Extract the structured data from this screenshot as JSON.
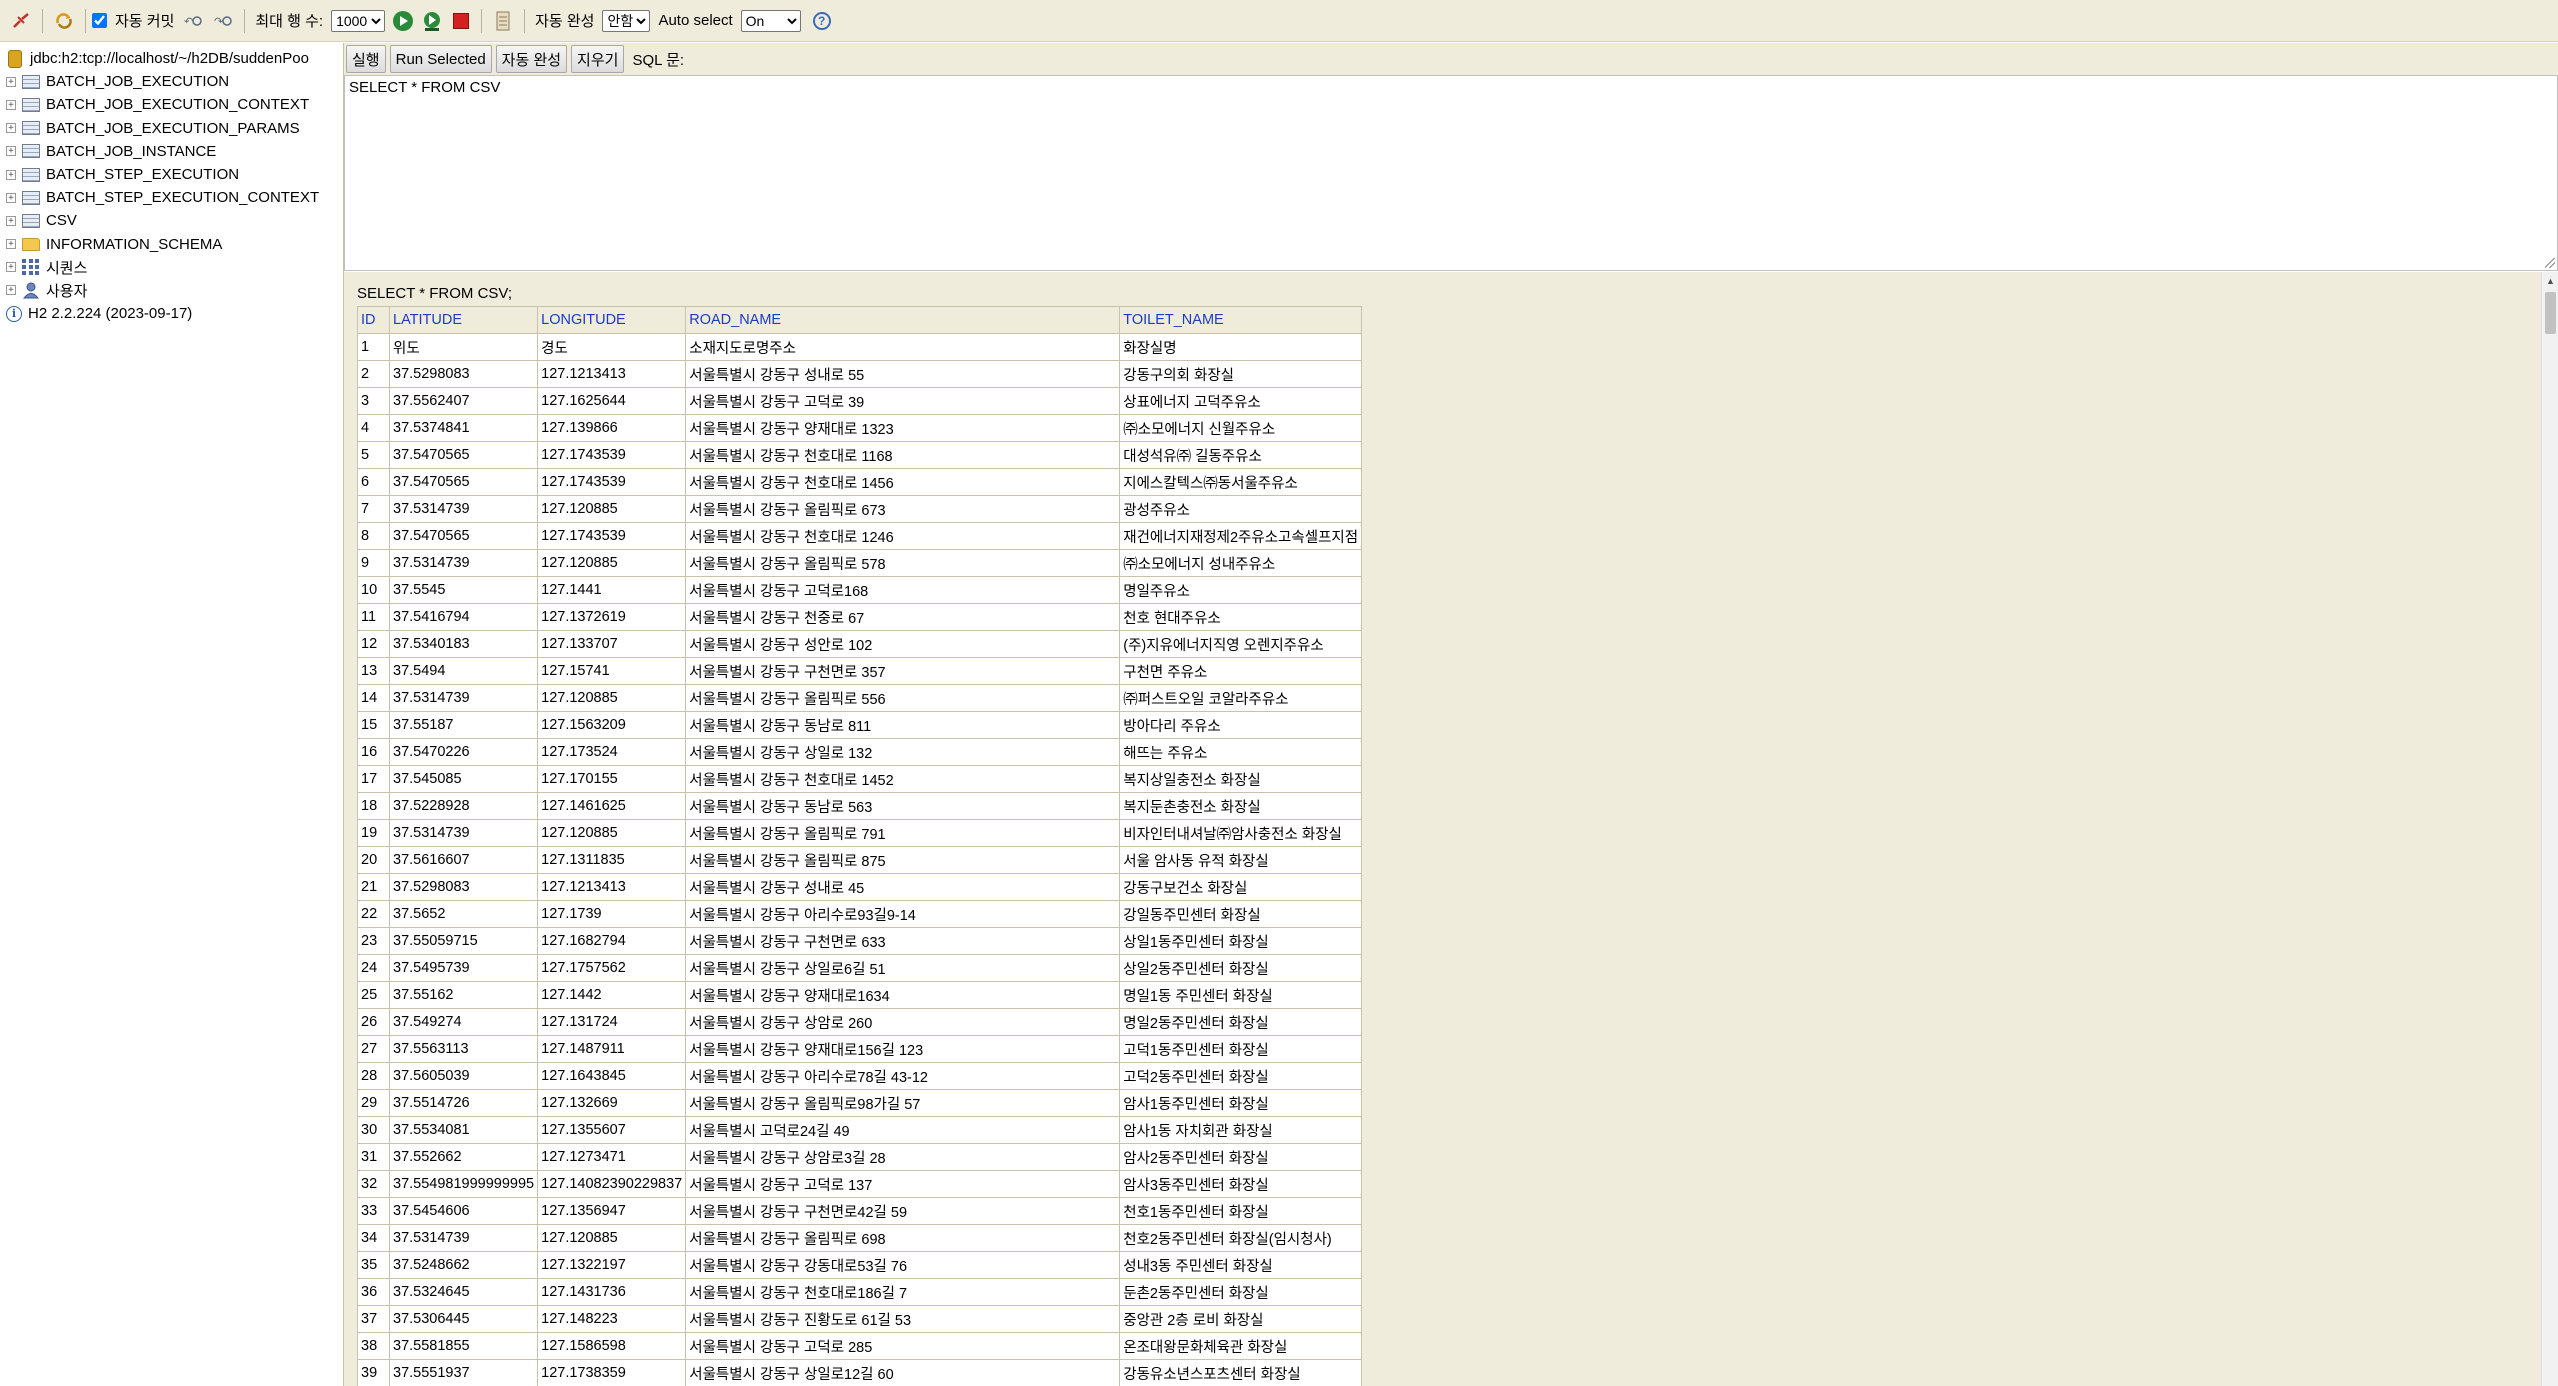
{
  "toolbar": {
    "autocommit_label": "자동 커밋",
    "autocommit_checked": true,
    "max_rows_label": "최대 행 수:",
    "max_rows_value": "1000",
    "autocomplete_label": "자동 완성",
    "autocomplete_value": "안함",
    "autoselect_label": "Auto select",
    "autoselect_value": "On",
    "help_glyph": "?"
  },
  "tree": {
    "connection": "jdbc:h2:tcp://localhost/~/h2DB/suddenPoo",
    "tables": [
      "BATCH_JOB_EXECUTION",
      "BATCH_JOB_EXECUTION_CONTEXT",
      "BATCH_JOB_EXECUTION_PARAMS",
      "BATCH_JOB_INSTANCE",
      "BATCH_STEP_EXECUTION",
      "BATCH_STEP_EXECUTION_CONTEXT",
      "CSV"
    ],
    "schema": "INFORMATION_SCHEMA",
    "sequences": "시퀀스",
    "users": "사용자",
    "version": "H2 2.2.224 (2023-09-17)"
  },
  "sql_toolbar": {
    "run": "실행",
    "run_selected": "Run Selected",
    "autocomplete": "자동 완성",
    "clear": "지우기",
    "sql_label": "SQL 문:"
  },
  "sql_editor": {
    "text": "SELECT * FROM CSV"
  },
  "result": {
    "query": "SELECT * FROM CSV;",
    "columns": [
      "ID",
      "LATITUDE",
      "LONGITUDE",
      "ROAD_NAME",
      "TOILET_NAME"
    ],
    "rows": [
      [
        "1",
        "위도",
        "경도",
        "소재지도로명주소",
        "화장실명"
      ],
      [
        "2",
        "37.5298083",
        "127.1213413",
        "서울특별시 강동구 성내로 55",
        "강동구의회 화장실"
      ],
      [
        "3",
        "37.5562407",
        "127.1625644",
        "서울특별시 강동구 고덕로 39",
        "상표에너지 고덕주유소"
      ],
      [
        "4",
        "37.5374841",
        "127.139866",
        "서울특별시 강동구 양재대로 1323",
        "㈜소모에너지 신월주유소"
      ],
      [
        "5",
        "37.5470565",
        "127.1743539",
        "서울특별시 강동구 천호대로 1168",
        "대성석유㈜ 길동주유소"
      ],
      [
        "6",
        "37.5470565",
        "127.1743539",
        "서울특별시 강동구 천호대로 1456",
        "지에스칼텍스㈜동서울주유소"
      ],
      [
        "7",
        "37.5314739",
        "127.120885",
        "서울특별시 강동구 올림픽로 673",
        "광성주유소"
      ],
      [
        "8",
        "37.5470565",
        "127.1743539",
        "서울특별시 강동구 천호대로 1246",
        "재건에너지재정제2주유소고속셀프지점"
      ],
      [
        "9",
        "37.5314739",
        "127.120885",
        "서울특별시 강동구 올림픽로 578",
        "㈜소모에너지 성내주유소"
      ],
      [
        "10",
        "37.5545",
        "127.1441",
        "서울특별시 강동구 고덕로168",
        "명일주유소"
      ],
      [
        "11",
        "37.5416794",
        "127.1372619",
        "서울특별시 강동구 천중로 67",
        "천호 현대주유소"
      ],
      [
        "12",
        "37.5340183",
        "127.133707",
        "서울특별시 강동구 성안로 102",
        "(주)지유에너지직영 오렌지주유소"
      ],
      [
        "13",
        "37.5494",
        "127.15741",
        "서울특별시 강동구 구천면로 357",
        "구천면 주유소"
      ],
      [
        "14",
        "37.5314739",
        "127.120885",
        "서울특별시 강동구 올림픽로 556",
        "㈜퍼스트오일 코알라주유소"
      ],
      [
        "15",
        "37.55187",
        "127.1563209",
        "서울특별시 강동구 동남로 811",
        "방아다리 주유소"
      ],
      [
        "16",
        "37.5470226",
        "127.173524",
        "서울특별시 강동구 상일로 132",
        "해뜨는 주유소"
      ],
      [
        "17",
        "37.545085",
        "127.170155",
        "서울특별시 강동구 천호대로 1452",
        "복지상일충전소 화장실"
      ],
      [
        "18",
        "37.5228928",
        "127.1461625",
        "서울특별시 강동구 동남로 563",
        "복지둔촌충전소 화장실"
      ],
      [
        "19",
        "37.5314739",
        "127.120885",
        "서울특별시 강동구 올림픽로 791",
        "비자인터내셔날㈜암사충전소 화장실"
      ],
      [
        "20",
        "37.5616607",
        "127.1311835",
        "서울특별시 강동구 올림픽로 875",
        "서울 암사동 유적 화장실"
      ],
      [
        "21",
        "37.5298083",
        "127.1213413",
        "서울특별시 강동구 성내로 45",
        "강동구보건소 화장실"
      ],
      [
        "22",
        "37.5652",
        "127.1739",
        "서울특별시 강동구 아리수로93길9-14",
        "강일동주민센터 화장실"
      ],
      [
        "23",
        "37.55059715",
        "127.1682794",
        "서울특별시 강동구 구천면로 633",
        "상일1동주민센터 화장실"
      ],
      [
        "24",
        "37.5495739",
        "127.1757562",
        "서울특별시 강동구 상일로6길 51",
        "상일2동주민센터 화장실"
      ],
      [
        "25",
        "37.55162",
        "127.1442",
        "서울특별시 강동구 양재대로1634",
        "명일1동 주민센터 화장실"
      ],
      [
        "26",
        "37.549274",
        "127.131724",
        "서울특별시 강동구 상암로 260",
        "명일2동주민센터 화장실"
      ],
      [
        "27",
        "37.5563113",
        "127.1487911",
        "서울특별시 강동구 양재대로156길 123",
        "고덕1동주민센터 화장실"
      ],
      [
        "28",
        "37.5605039",
        "127.1643845",
        "서울특별시 강동구 아리수로78길 43-12",
        "고덕2동주민센터 화장실"
      ],
      [
        "29",
        "37.5514726",
        "127.132669",
        "서울특별시 강동구 올림픽로98가길 57",
        "암사1동주민센터 화장실"
      ],
      [
        "30",
        "37.5534081",
        "127.1355607",
        "서울특별시 고덕로24길 49",
        "암사1동 자치회관 화장실"
      ],
      [
        "31",
        "37.552662",
        "127.1273471",
        "서울특별시 강동구 상암로3길 28",
        "암사2동주민센터 화장실"
      ],
      [
        "32",
        "37.554981999999995",
        "127.14082390229837",
        "서울특별시 강동구 고덕로 137",
        "암사3동주민센터 화장실"
      ],
      [
        "33",
        "37.5454606",
        "127.1356947",
        "서울특별시 강동구 구천면로42길 59",
        "천호1동주민센터 화장실"
      ],
      [
        "34",
        "37.5314739",
        "127.120885",
        "서울특별시 강동구 올림픽로 698",
        "천호2동주민센터 화장실(임시청사)"
      ],
      [
        "35",
        "37.5248662",
        "127.1322197",
        "서울특별시 강동구 강동대로53길 76",
        "성내3동 주민센터 화장실"
      ],
      [
        "36",
        "37.5324645",
        "127.1431736",
        "서울특별시 강동구 천호대로186길 7",
        "둔촌2동주민센터 화장실"
      ],
      [
        "37",
        "37.5306445",
        "127.148223",
        "서울특별시 강동구 진황도로 61길 53",
        "중앙관 2층 로비 화장실"
      ],
      [
        "38",
        "37.5581855",
        "127.1586598",
        "서울특별시  강동구 고덕로 285",
        "온조대왕문화체육관 화장실"
      ],
      [
        "39",
        "37.5551937",
        "127.1738359",
        "서울특별시 강동구 상일로12길 60",
        "강동유소년스포츠센터 화장실"
      ]
    ]
  },
  "colors": {
    "panel_bg": "#f0ecdc",
    "header_text": "#1a3cc8",
    "grid_border": "#c8c2aa"
  }
}
